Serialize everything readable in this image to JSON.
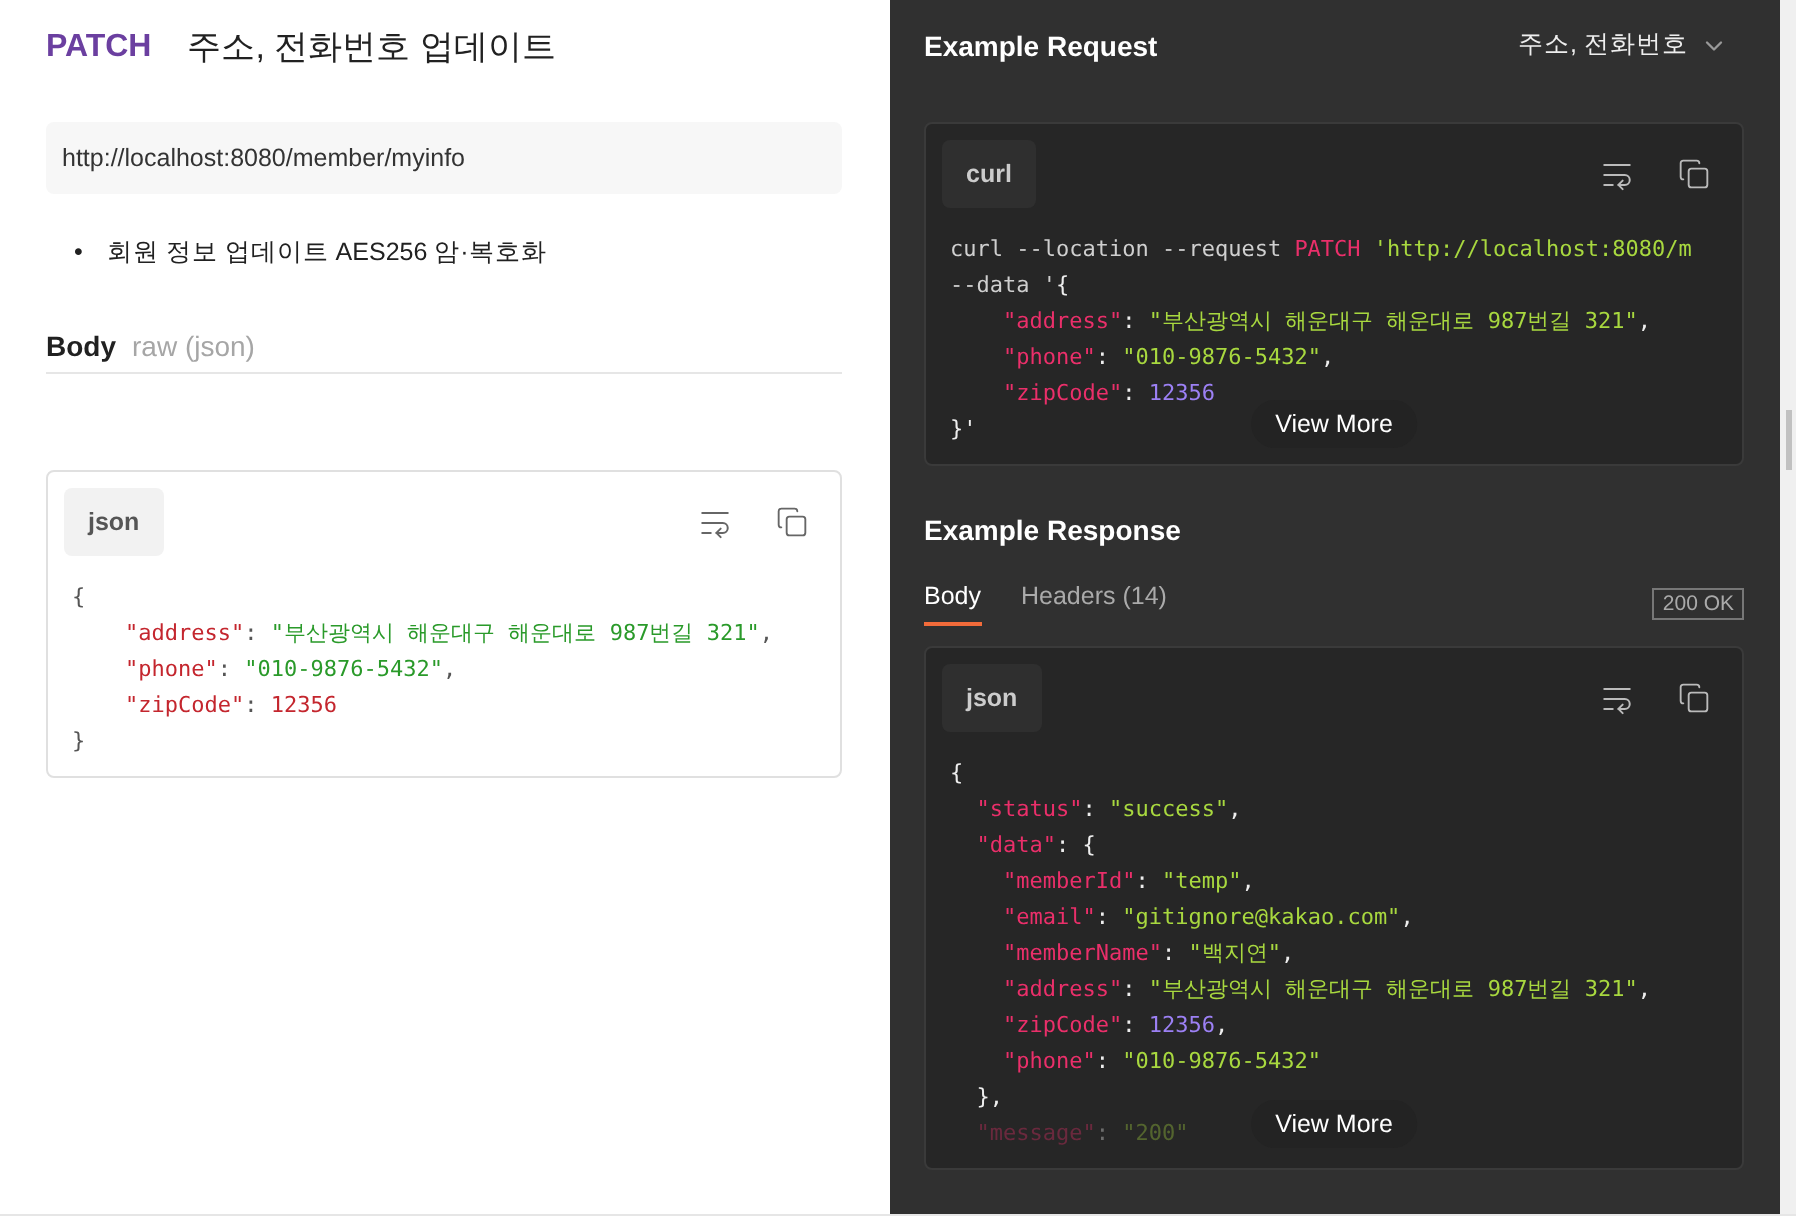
{
  "request": {
    "method": "PATCH",
    "title": "주소, 전화번호 업데이트",
    "url": "http://localhost:8080/member/myinfo",
    "notes": [
      {
        "bullet": "•",
        "text": "회원 정보 업데이트 AES256 암·복호화"
      }
    ],
    "body": {
      "label": "Body",
      "mode": "raw (json)",
      "language": "json",
      "lines": [
        [
          {
            "kind": "punct",
            "text": "{"
          }
        ],
        [
          {
            "kind": "key",
            "text": "    \"address\""
          },
          {
            "kind": "punct",
            "text": ": "
          },
          {
            "kind": "string",
            "text": "\"부산광역시 해운대구 해운대로 987번길 321\""
          },
          {
            "kind": "punct",
            "text": ","
          }
        ],
        [
          {
            "kind": "key",
            "text": "    \"phone\""
          },
          {
            "kind": "punct",
            "text": ": "
          },
          {
            "kind": "string",
            "text": "\"010-9876-5432\""
          },
          {
            "kind": "punct",
            "text": ","
          }
        ],
        [
          {
            "kind": "key",
            "text": "    \"zipCode\""
          },
          {
            "kind": "punct",
            "text": ": "
          },
          {
            "kind": "number",
            "text": "12356"
          }
        ],
        [
          {
            "kind": "punct",
            "text": "}"
          }
        ]
      ]
    }
  },
  "example_request": {
    "title": "Example Request",
    "selector": "주소, 전화번호",
    "language": "curl",
    "more": "View More",
    "lines": [
      [
        {
          "kind": "plain",
          "text": "curl --location --request "
        },
        {
          "kind": "method",
          "text": "PATCH"
        },
        {
          "kind": "string",
          "text": " 'http://localhost:8080/m"
        }
      ],
      [
        {
          "kind": "plain",
          "text": "--data '"
        },
        {
          "kind": "punct",
          "text": "{"
        }
      ],
      [
        {
          "kind": "key",
          "text": "    \"address\""
        },
        {
          "kind": "punct",
          "text": ": "
        },
        {
          "kind": "string",
          "text": "\"부산광역시 해운대구 해운대로 987번길 321\""
        },
        {
          "kind": "punct",
          "text": ","
        }
      ],
      [
        {
          "kind": "key",
          "text": "    \"phone\""
        },
        {
          "kind": "punct",
          "text": ": "
        },
        {
          "kind": "string",
          "text": "\"010-9876-5432\""
        },
        {
          "kind": "punct",
          "text": ","
        }
      ],
      [
        {
          "kind": "key",
          "text": "    \"zipCode\""
        },
        {
          "kind": "punct",
          "text": ": "
        },
        {
          "kind": "number",
          "text": "12356"
        }
      ],
      [
        {
          "kind": "punct",
          "text": "}'"
        }
      ]
    ]
  },
  "example_response": {
    "title": "Example Response",
    "tabs": [
      {
        "label": "Body",
        "selected": true
      },
      {
        "label": "Headers (14)",
        "selected": false
      }
    ],
    "status": "200 OK",
    "language": "json",
    "more": "View More",
    "lines": [
      [
        {
          "kind": "punct",
          "text": "{"
        }
      ],
      [
        {
          "kind": "key",
          "text": "  \"status\""
        },
        {
          "kind": "punct",
          "text": ": "
        },
        {
          "kind": "string",
          "text": "\"success\""
        },
        {
          "kind": "punct",
          "text": ","
        }
      ],
      [
        {
          "kind": "key",
          "text": "  \"data\""
        },
        {
          "kind": "punct",
          "text": ": {"
        }
      ],
      [
        {
          "kind": "key",
          "text": "    \"memberId\""
        },
        {
          "kind": "punct",
          "text": ": "
        },
        {
          "kind": "string",
          "text": "\"temp\""
        },
        {
          "kind": "punct",
          "text": ","
        }
      ],
      [
        {
          "kind": "key",
          "text": "    \"email\""
        },
        {
          "kind": "punct",
          "text": ": "
        },
        {
          "kind": "string",
          "text": "\"gitignore@kakao.com\""
        },
        {
          "kind": "punct",
          "text": ","
        }
      ],
      [
        {
          "kind": "key",
          "text": "    \"memberName\""
        },
        {
          "kind": "punct",
          "text": ": "
        },
        {
          "kind": "string",
          "text": "\"백지연\""
        },
        {
          "kind": "punct",
          "text": ","
        }
      ],
      [
        {
          "kind": "key",
          "text": "    \"address\""
        },
        {
          "kind": "punct",
          "text": ": "
        },
        {
          "kind": "string",
          "text": "\"부산광역시 해운대구 해운대로 987번길 321\""
        },
        {
          "kind": "punct",
          "text": ","
        }
      ],
      [
        {
          "kind": "key",
          "text": "    \"zipCode\""
        },
        {
          "kind": "punct",
          "text": ": "
        },
        {
          "kind": "number",
          "text": "12356"
        },
        {
          "kind": "punct",
          "text": ","
        }
      ],
      [
        {
          "kind": "key",
          "text": "    \"phone\""
        },
        {
          "kind": "punct",
          "text": ": "
        },
        {
          "kind": "string",
          "text": "\"010-9876-5432\""
        }
      ],
      [
        {
          "kind": "punct",
          "text": "  },"
        }
      ],
      [
        {
          "kind": "key",
          "text": "  \"message\""
        },
        {
          "kind": "punct",
          "text": ": "
        },
        {
          "kind": "string",
          "text": "\"200\""
        }
      ]
    ]
  }
}
